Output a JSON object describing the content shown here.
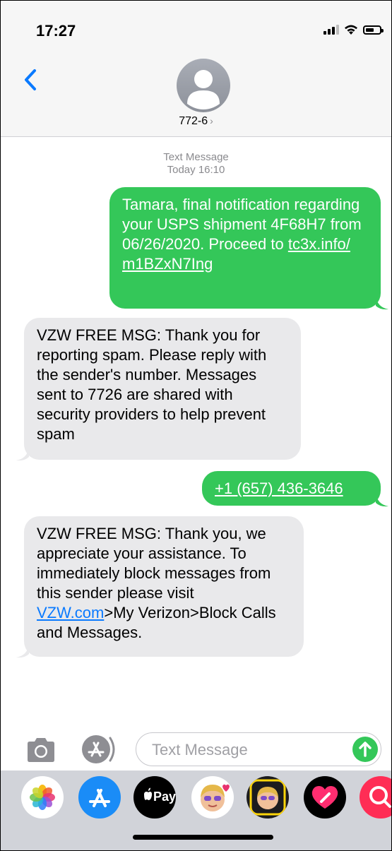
{
  "status_bar": {
    "time": "17:27"
  },
  "header": {
    "contact": "772-6",
    "chevron": "›"
  },
  "thread": {
    "meta_line1": "Text Message",
    "meta_line2": "Today 16:10",
    "messages": [
      {
        "direction": "outgoing",
        "text": "Tamara, final notification regarding your USPS shipment 4F68H7 from 06/26/2020. Proceed to ",
        "link": "tc3x.info/ m1BZxN7Ing"
      },
      {
        "direction": "incoming",
        "text": "VZW FREE MSG: Thank you for reporting spam. Please reply with the sender's number. Messages sent to 7726 are shared with security providers to help prevent spam"
      },
      {
        "direction": "outgoing",
        "link": "+1 (657) 436-3646"
      },
      {
        "direction": "incoming",
        "text_before": "VZW FREE MSG: Thank you, we appreciate your assistance. To immediately block messages from this sender please visit ",
        "link": "VZW.com",
        "text_after": ">My Verizon>Block Calls and Messages."
      }
    ]
  },
  "compose": {
    "placeholder": "Text Message",
    "value": ""
  },
  "app_drawer": {
    "apps": [
      {
        "icon": "photos-icon"
      },
      {
        "icon": "app-store-icon"
      },
      {
        "icon": "apple-pay-icon",
        "label": "Pay"
      },
      {
        "icon": "memoji-icon"
      },
      {
        "icon": "memoji-sticker-icon"
      },
      {
        "icon": "digital-touch-icon"
      },
      {
        "icon": "images-search-icon"
      }
    ]
  },
  "colors": {
    "outgoing_bubble": "#34c759",
    "incoming_bubble": "#e9e9eb",
    "accent": "#0a7aff"
  }
}
